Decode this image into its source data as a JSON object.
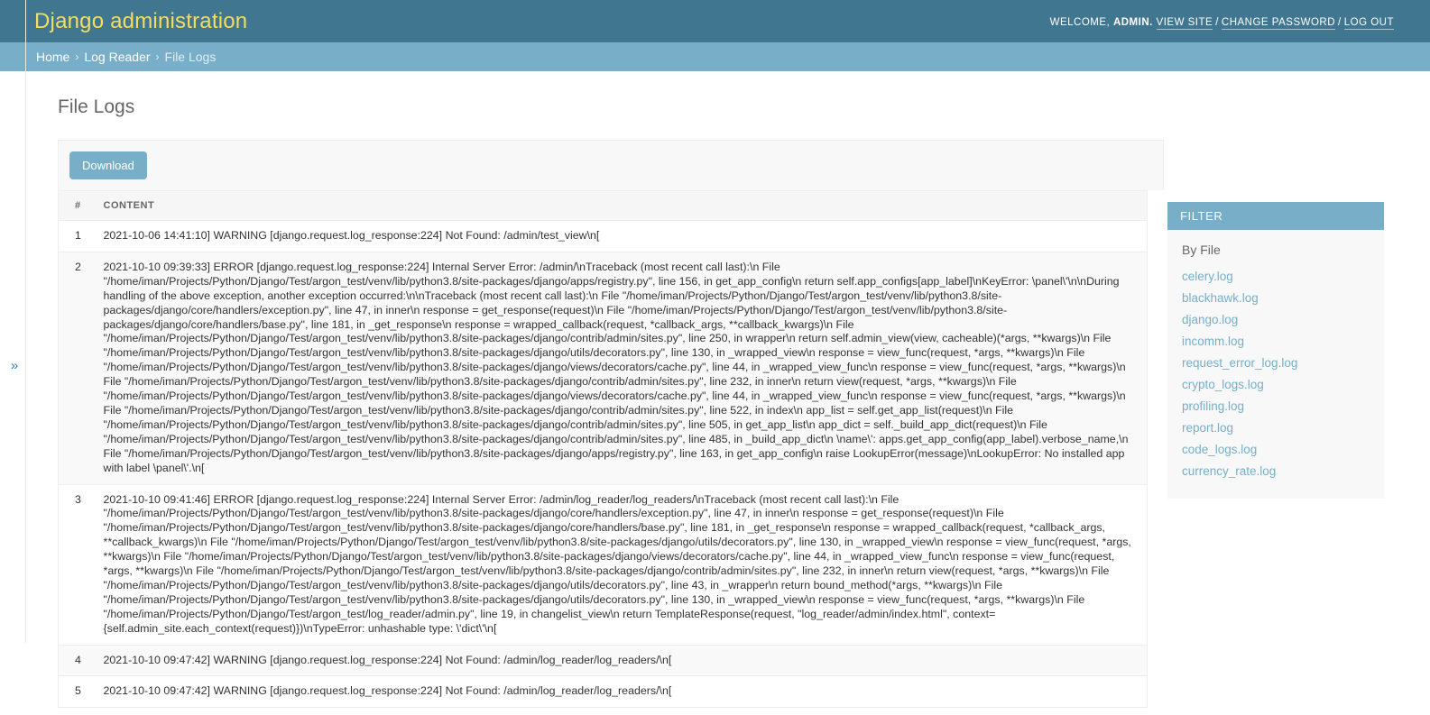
{
  "header": {
    "site_title": "Django administration",
    "welcome_prefix": "WELCOME,",
    "username": "ADMIN.",
    "view_site": "VIEW SITE",
    "change_password": "CHANGE PASSWORD",
    "log_out": "LOG OUT",
    "separator": "/"
  },
  "breadcrumbs": {
    "home": "Home",
    "app": "Log Reader",
    "current": "File Logs",
    "separator": "›"
  },
  "page": {
    "title": "File Logs",
    "sidebar_toggle_icon": "»"
  },
  "toolbar": {
    "download_label": "Download"
  },
  "table": {
    "columns": [
      "#",
      "CONTENT"
    ],
    "rows": [
      {
        "num": "1",
        "content": "2021-10-06 14:41:10] WARNING [django.request.log_response:224] Not Found: /admin/test_view\\n["
      },
      {
        "num": "2",
        "content": "2021-10-10 09:39:33] ERROR [django.request.log_response:224] Internal Server Error: /admin/\\nTraceback (most recent call last):\\n File \"/home/iman/Projects/Python/Django/Test/argon_test/venv/lib/python3.8/site-packages/django/apps/registry.py\", line 156, in get_app_config\\n return self.app_configs[app_label]\\nKeyError: \\panel\\'\\n\\nDuring handling of the above exception, another exception occurred:\\n\\nTraceback (most recent call last):\\n File \"/home/iman/Projects/Python/Django/Test/argon_test/venv/lib/python3.8/site-packages/django/core/handlers/exception.py\", line 47, in inner\\n response = get_response(request)\\n File \"/home/iman/Projects/Python/Django/Test/argon_test/venv/lib/python3.8/site-packages/django/core/handlers/base.py\", line 181, in _get_response\\n response = wrapped_callback(request, *callback_args, **callback_kwargs)\\n File \"/home/iman/Projects/Python/Django/Test/argon_test/venv/lib/python3.8/site-packages/django/contrib/admin/sites.py\", line 250, in wrapper\\n return self.admin_view(view, cacheable)(*args, **kwargs)\\n File \"/home/iman/Projects/Python/Django/Test/argon_test/venv/lib/python3.8/site-packages/django/utils/decorators.py\", line 130, in _wrapped_view\\n response = view_func(request, *args, **kwargs)\\n File \"/home/iman/Projects/Python/Django/Test/argon_test/venv/lib/python3.8/site-packages/django/views/decorators/cache.py\", line 44, in _wrapped_view_func\\n response = view_func(request, *args, **kwargs)\\n File \"/home/iman/Projects/Python/Django/Test/argon_test/venv/lib/python3.8/site-packages/django/contrib/admin/sites.py\", line 232, in inner\\n return view(request, *args, **kwargs)\\n File \"/home/iman/Projects/Python/Django/Test/argon_test/venv/lib/python3.8/site-packages/django/views/decorators/cache.py\", line 44, in _wrapped_view_func\\n response = view_func(request, *args, **kwargs)\\n File \"/home/iman/Projects/Python/Django/Test/argon_test/venv/lib/python3.8/site-packages/django/contrib/admin/sites.py\", line 522, in index\\n app_list = self.get_app_list(request)\\n File \"/home/iman/Projects/Python/Django/Test/argon_test/venv/lib/python3.8/site-packages/django/contrib/admin/sites.py\", line 505, in get_app_list\\n app_dict = self._build_app_dict(request)\\n File \"/home/iman/Projects/Python/Django/Test/argon_test/venv/lib/python3.8/site-packages/django/contrib/admin/sites.py\", line 485, in _build_app_dict\\n \\name\\': apps.get_app_config(app_label).verbose_name,\\n File \"/home/iman/Projects/Python/Django/Test/argon_test/venv/lib/python3.8/site-packages/django/apps/registry.py\", line 163, in get_app_config\\n raise LookupError(message)\\nLookupError: No installed app with label \\panel\\'.\\n["
      },
      {
        "num": "3",
        "content": "2021-10-10 09:41:46] ERROR [django.request.log_response:224] Internal Server Error: /admin/log_reader/log_readers/\\nTraceback (most recent call last):\\n File \"/home/iman/Projects/Python/Django/Test/argon_test/venv/lib/python3.8/site-packages/django/core/handlers/exception.py\", line 47, in inner\\n response = get_response(request)\\n File \"/home/iman/Projects/Python/Django/Test/argon_test/venv/lib/python3.8/site-packages/django/core/handlers/base.py\", line 181, in _get_response\\n response = wrapped_callback(request, *callback_args, **callback_kwargs)\\n File \"/home/iman/Projects/Python/Django/Test/argon_test/venv/lib/python3.8/site-packages/django/utils/decorators.py\", line 130, in _wrapped_view\\n response = view_func(request, *args, **kwargs)\\n File \"/home/iman/Projects/Python/Django/Test/argon_test/venv/lib/python3.8/site-packages/django/views/decorators/cache.py\", line 44, in _wrapped_view_func\\n response = view_func(request, *args, **kwargs)\\n File \"/home/iman/Projects/Python/Django/Test/argon_test/venv/lib/python3.8/site-packages/django/contrib/admin/sites.py\", line 232, in inner\\n return view(request, *args, **kwargs)\\n File \"/home/iman/Projects/Python/Django/Test/argon_test/venv/lib/python3.8/site-packages/django/utils/decorators.py\", line 43, in _wrapper\\n return bound_method(*args, **kwargs)\\n File \"/home/iman/Projects/Python/Django/Test/argon_test/venv/lib/python3.8/site-packages/django/utils/decorators.py\", line 130, in _wrapped_view\\n response = view_func(request, *args, **kwargs)\\n File \"/home/iman/Projects/Python/Django/Test/argon_test/log_reader/admin.py\", line 19, in changelist_view\\n return TemplateResponse(request, \"log_reader/admin/index.html\", context={self.admin_site.each_context(request)})\\nTypeError: unhashable type: \\'dict\\'\\n["
      },
      {
        "num": "4",
        "content": "2021-10-10 09:47:42] WARNING [django.request.log_response:224] Not Found: /admin/log_reader/log_readers/\\n["
      },
      {
        "num": "5",
        "content": "2021-10-10 09:47:42] WARNING [django.request.log_response:224] Not Found: /admin/log_reader/log_readers/\\n["
      }
    ]
  },
  "filter": {
    "heading": "FILTER",
    "group_label": "By File",
    "items": [
      "celery.log",
      "blackhawk.log",
      "django.log",
      "incomm.log",
      "request_error_log.log",
      "crypto_logs.log",
      "profiling.log",
      "report.log",
      "code_logs.log",
      "currency_rate.log"
    ]
  },
  "colors": {
    "header_bg": "#417690",
    "breadcrumb_bg": "#79aec8",
    "brand_text": "#f5dd5d",
    "accent": "#79aec8",
    "link": "#79aec8",
    "toggle_icon": "#2b7fc4"
  }
}
